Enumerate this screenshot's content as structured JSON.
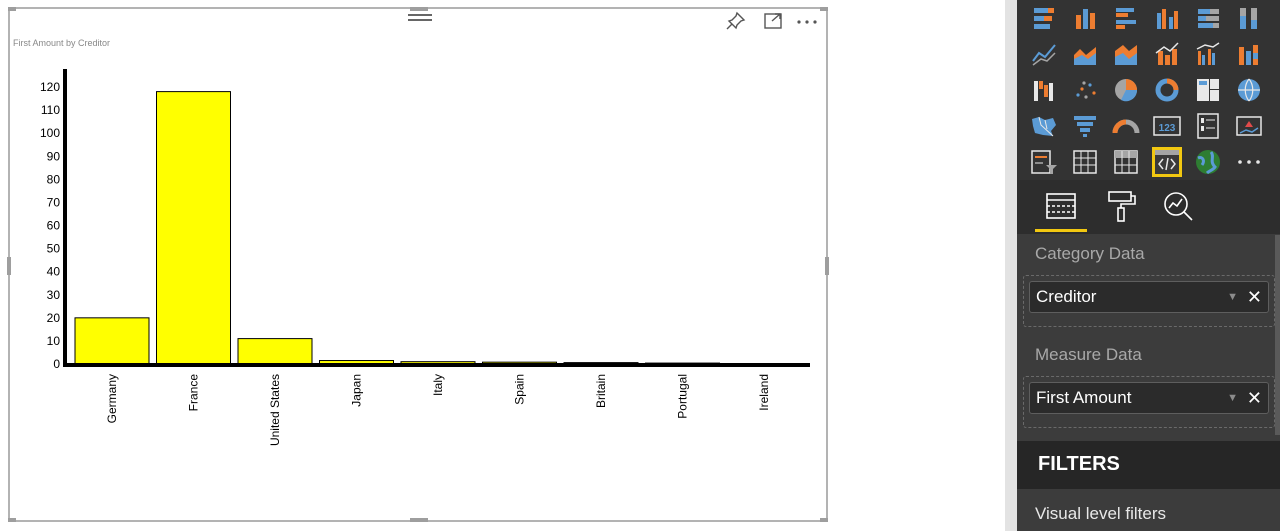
{
  "visual": {
    "title": "First Amount by Creditor"
  },
  "chart_data": {
    "type": "bar",
    "title": "First Amount by Creditor",
    "xlabel": "",
    "ylabel": "",
    "categories": [
      "Germany",
      "France",
      "United States",
      "Japan",
      "Italy",
      "Spain",
      "Britain",
      "Portugal",
      "Ireland"
    ],
    "values": [
      20,
      118,
      11,
      1.5,
      1,
      0.8,
      0.6,
      0.4,
      0.2
    ],
    "ylim": [
      0,
      120
    ],
    "yticks": [
      "0",
      "10",
      "20",
      "30",
      "40",
      "50",
      "60",
      "70",
      "80",
      "90",
      "100",
      "110",
      "120"
    ],
    "grid": false,
    "bar_color": "#ffff00"
  },
  "viz_pane": {
    "icons": [
      "stacked-bar-icon",
      "stacked-column-icon",
      "clustered-bar-icon",
      "clustered-column-icon",
      "100-stacked-bar-icon",
      "100-stacked-column-icon",
      "line-chart-icon",
      "area-chart-icon",
      "stacked-area-icon",
      "line-column-icon",
      "line-clustered-column-icon",
      "ribbon-chart-icon",
      "waterfall-icon",
      "scatter-icon",
      "pie-chart-icon",
      "donut-chart-icon",
      "treemap-icon",
      "map-icon",
      "filled-map-icon",
      "funnel-icon",
      "gauge-icon",
      "card-icon",
      "multi-row-card-icon",
      "kpi-icon",
      "slicer-icon",
      "table-icon",
      "matrix-icon",
      "custom-visual-icon",
      "globe-map-icon",
      "more-icon"
    ],
    "selected_icon": "custom-visual-icon",
    "tabs": [
      "fields-tab",
      "format-tab",
      "analytics-tab"
    ],
    "wells": [
      {
        "label": "Category Data",
        "field": "Creditor"
      },
      {
        "label": "Measure Data",
        "field": "First Amount"
      }
    ],
    "filters_header": "FILTERS",
    "visual_level_filters": "Visual level filters",
    "accent": "#f2c811"
  }
}
